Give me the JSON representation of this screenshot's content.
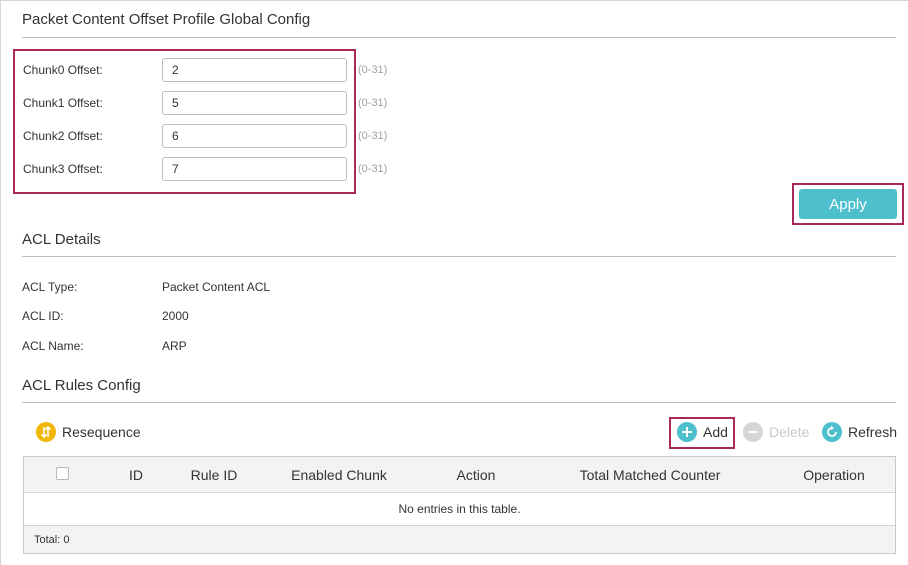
{
  "offset_section": {
    "title": "Packet Content Offset Profile Global Config",
    "fields": [
      {
        "label": "Chunk0 Offset:",
        "value": "2",
        "range": "(0-31)"
      },
      {
        "label": "Chunk1 Offset:",
        "value": "5",
        "range": "(0-31)"
      },
      {
        "label": "Chunk2 Offset:",
        "value": "6",
        "range": "(0-31)"
      },
      {
        "label": "Chunk3 Offset:",
        "value": "7",
        "range": "(0-31)"
      }
    ],
    "apply_label": "Apply"
  },
  "acl_details": {
    "title": "ACL Details",
    "rows": [
      {
        "label": "ACL Type:",
        "value": "Packet Content ACL"
      },
      {
        "label": "ACL ID:",
        "value": "2000"
      },
      {
        "label": "ACL Name:",
        "value": "ARP"
      }
    ]
  },
  "rules_config": {
    "title": "ACL Rules Config",
    "toolbar": {
      "resequence": {
        "label": "Resequence",
        "icon": "resequence-icon",
        "color": "#f2b705"
      },
      "add": {
        "label": "Add",
        "icon": "plus-icon",
        "color": "#4ebfcc"
      },
      "delete": {
        "label": "Delete",
        "icon": "minus-icon",
        "color": "#cfcfcf",
        "disabled": true
      },
      "refresh": {
        "label": "Refresh",
        "icon": "refresh-icon",
        "color": "#4ebfcc"
      }
    },
    "table": {
      "columns": [
        "ID",
        "Rule ID",
        "Enabled Chunk",
        "Action",
        "Total Matched Counter",
        "Operation"
      ],
      "empty_message": "No entries in this table.",
      "total": "Total: 0"
    }
  },
  "colors": {
    "accent": "#4ebfcc",
    "highlight": "#a8285a",
    "resequence": "#f2b705"
  }
}
